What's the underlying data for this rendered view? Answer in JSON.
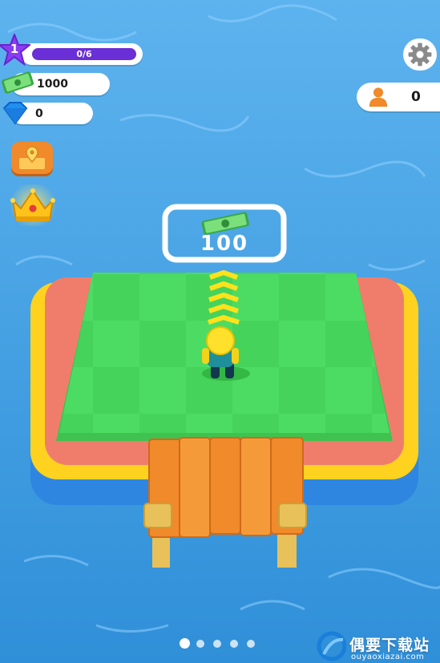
{
  "hud": {
    "level": "1",
    "level_progress_text": "0/6",
    "level_progress": 0,
    "cash": "1000",
    "gems": "0",
    "workers": "0"
  },
  "board": {
    "price": "100"
  },
  "pagination": {
    "pages": 5,
    "current": 1
  },
  "watermark": {
    "cn": "偶要下载站",
    "url": "ouyaoxiazai.com"
  },
  "colors": {
    "water": "#4aa6e6",
    "grass": "#4ddc63",
    "progress": "#6a2fd6",
    "dock": "#f08a2a"
  }
}
